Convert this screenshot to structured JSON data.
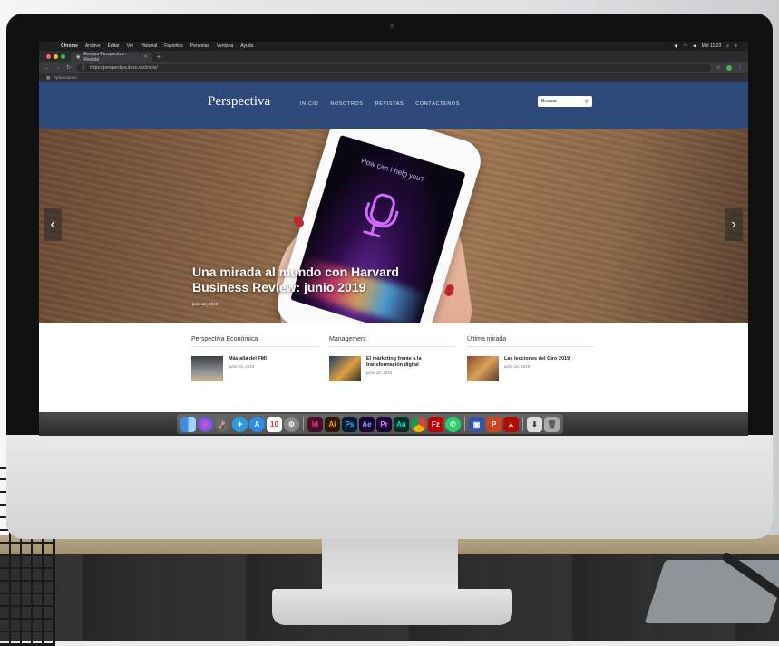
{
  "browser": {
    "menubar": {
      "app": "Chrome",
      "items": [
        "Archivo",
        "Editar",
        "Ver",
        "Historial",
        "Favoritos",
        "Personas",
        "Ventana",
        "Ayuda"
      ],
      "clock": "Mié 11:23"
    },
    "tab_title": "Revista Perspectiva - Revista ",
    "url": "https://perspectiva.iteso.mx/inicio/",
    "bookmarks_label": "Aplicaciones"
  },
  "site": {
    "logo": "Perspectiva",
    "nav": [
      "INICIO",
      "NOSOTROS",
      "REVISTAS",
      "CONTÁCTENOS"
    ],
    "search_placeholder": "Buscar",
    "hero": {
      "title": "Una mirada al mundo con Harvard Business Review: junio 2019",
      "date": "junio 20, 2019",
      "phone_prompt": "How can I help you?"
    },
    "columns": [
      {
        "title": "Perspectiva Económica",
        "post_title": "Más allá del FMI",
        "post_date": "junio 20, 2019"
      },
      {
        "title": "Management",
        "post_title": "El marketing frente a la transformación digital",
        "post_date": "junio 20, 2019"
      },
      {
        "title": "Última mirada",
        "post_title": "Las lecciones del Giro 2019",
        "post_date": "junio 20, 2019"
      }
    ]
  },
  "dock": {
    "icons": [
      "finder-icon",
      "siri-icon",
      "launchpad-icon",
      "safari-icon",
      "app-store-icon",
      "calendar-icon",
      "preferences-icon",
      "indesign-icon",
      "illustrator-icon",
      "photoshop-icon",
      "after-effects-icon",
      "premiere-icon",
      "audition-icon",
      "chrome-icon",
      "filezilla-icon",
      "whatsapp-icon",
      "preview-icon",
      "powerpoint-icon",
      "acrobat-icon",
      "downloads-icon",
      "trash-icon"
    ],
    "labels": {
      "calendar": "10",
      "indesign": "Id",
      "illustrator": "Ai",
      "photoshop": "Ps",
      "after_effects": "Ae",
      "premiere": "Pr",
      "audition": "Au",
      "filezilla": "Fz"
    }
  },
  "colors": {
    "nav_bg": "#2e4a7b",
    "accent_red": "#c0262d"
  }
}
